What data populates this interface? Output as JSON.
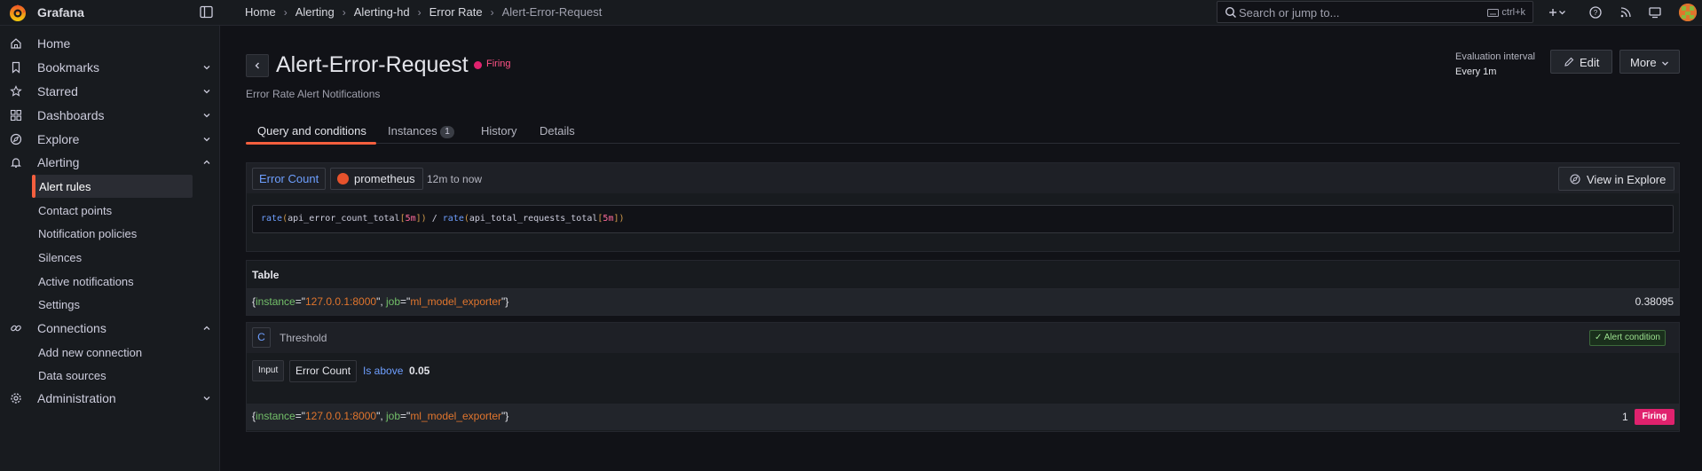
{
  "app": {
    "brand": "Grafana",
    "accent_color": "#f55f3e"
  },
  "breadcrumb": [
    "Home",
    "Alerting",
    "Alerting-hd",
    "Error Rate",
    "Alert-Error-Request"
  ],
  "search": {
    "placeholder": "Search or jump to...",
    "shortcut": "ctrl+k"
  },
  "sidebar": {
    "items": [
      {
        "label": "Home",
        "icon": "home-icon"
      },
      {
        "label": "Bookmarks",
        "icon": "bookmark-icon",
        "expandable": true
      },
      {
        "label": "Starred",
        "icon": "star-icon",
        "expandable": true
      },
      {
        "label": "Dashboards",
        "icon": "apps-icon",
        "expandable": true
      },
      {
        "label": "Explore",
        "icon": "compass-icon",
        "expandable": true
      },
      {
        "label": "Alerting",
        "icon": "bell-icon",
        "expanded": true
      },
      {
        "label": "Connections",
        "icon": "link-icon",
        "expanded": true
      },
      {
        "label": "Administration",
        "icon": "cog-icon",
        "expandable": true
      }
    ],
    "alerting_children": [
      "Alert rules",
      "Contact points",
      "Notification policies",
      "Silences",
      "Active notifications",
      "Settings"
    ],
    "connections_children": [
      "Add new connection",
      "Data sources"
    ],
    "active_item": "Alert rules"
  },
  "rule": {
    "title": "Alert-Error-Request",
    "state": "Firing",
    "state_color": "#e0226e",
    "summary": "Error Rate Alert Notifications",
    "evaluation_label": "Evaluation interval",
    "evaluation_value": "Every 1m",
    "edit_label": "Edit",
    "more_label": "More"
  },
  "tabs": [
    {
      "label": "Query and conditions",
      "active": true
    },
    {
      "label": "Instances",
      "count": "1"
    },
    {
      "label": "History"
    },
    {
      "label": "Details"
    }
  ],
  "query": {
    "ref_id": "Error Count",
    "datasource": "prometheus",
    "time_range": "12m to now",
    "explore_label": "View in Explore",
    "expr_parts": {
      "fn1": "rate",
      "metric1": "api_error_count_total",
      "range1": "5m",
      "op": " / ",
      "fn2": "rate",
      "metric2": "api_total_requests_total",
      "range2": "5m"
    }
  },
  "table": {
    "title": "Table",
    "row": {
      "labels": [
        {
          "key": "instance",
          "value": "127.0.0.1:8000"
        },
        {
          "key": "job",
          "value": "ml_model_exporter"
        }
      ],
      "value": "0.38095"
    }
  },
  "threshold": {
    "ref_id": "C",
    "type": "Threshold",
    "alert_condition_label": "Alert condition",
    "input_label": "Input",
    "input_value": "Error Count",
    "operator": "Is above",
    "value": "0.05",
    "row": {
      "labels": [
        {
          "key": "instance",
          "value": "127.0.0.1:8000"
        },
        {
          "key": "job",
          "value": "ml_model_exporter"
        }
      ],
      "value": "1",
      "state": "Firing"
    }
  }
}
